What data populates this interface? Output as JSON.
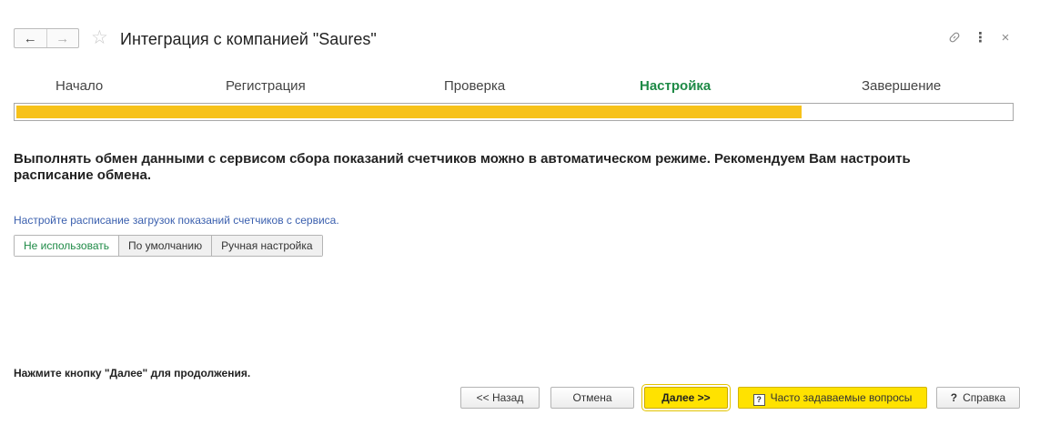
{
  "header": {
    "back_icon": "←",
    "forward_icon": "→",
    "star_icon": "☆",
    "title": "Интеграция с компанией \"Saures\"",
    "link_icon": "⛓",
    "more_icon": "⋮",
    "close_icon": "×"
  },
  "steps": [
    {
      "label": "Начало",
      "active": false
    },
    {
      "label": "Регистрация",
      "active": false
    },
    {
      "label": "Проверка",
      "active": false
    },
    {
      "label": "Настройка",
      "active": true
    },
    {
      "label": "Завершение",
      "active": false
    }
  ],
  "progress": {
    "fraction": 0.79,
    "color": "#f7c21a"
  },
  "main_text": "Выполнять обмен данными с сервисом сбора показаний счетчиков можно в автоматическом режиме. Рекомендуем Вам настроить расписание обмена.",
  "schedule": {
    "hint": "Настройте расписание загрузок показаний счетчиков с сервиса.",
    "options": [
      "Не использовать",
      "По умолчанию",
      "Ручная настройка"
    ],
    "selected": "Не использовать"
  },
  "footer_text": "Нажмите кнопку \"Далее\" для продолжения.",
  "buttons": {
    "back": "<< Назад",
    "cancel": "Отмена",
    "next": "Далее >>",
    "faq": "Часто задаваемые вопросы",
    "faq_icon": "?",
    "help": "Справка",
    "help_icon": "?"
  },
  "colors": {
    "accent_green": "#1e8a46",
    "link_blue": "#3a5fae",
    "primary_yellow": "#ffe200"
  }
}
